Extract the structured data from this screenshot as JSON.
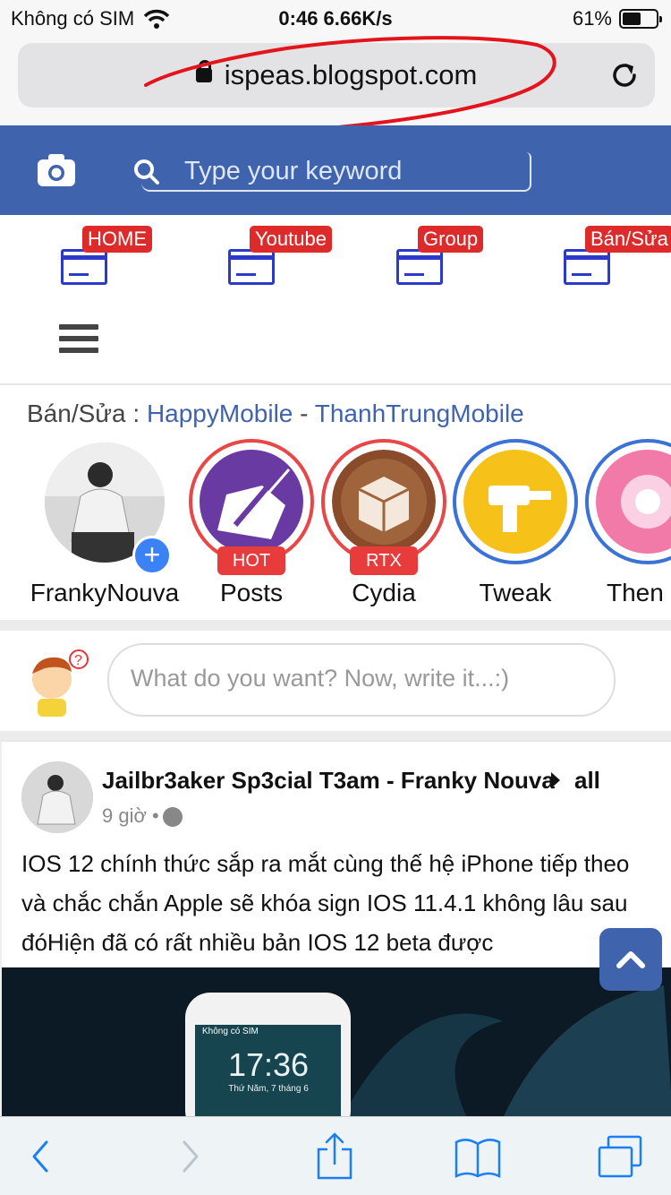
{
  "status_bar": {
    "carrier": "Không có SIM",
    "time_speed": "0:46 6.66K/s",
    "battery": "61%",
    "battery_level": 0.61
  },
  "browser": {
    "url": "ispeas.blogspot.com"
  },
  "header": {
    "search_placeholder": "Type your keyword"
  },
  "quicklinks": [
    {
      "label": "HOME"
    },
    {
      "label": "Youtube"
    },
    {
      "label": "Group"
    },
    {
      "label": "Bán/Sửa"
    }
  ],
  "stories_section": {
    "prefix": "Bán/Sửa : ",
    "link1": "HappyMobile",
    "sep": " - ",
    "link2": "ThanhTrungMobile",
    "items": [
      {
        "label": "FrankyNouva",
        "badge": ""
      },
      {
        "label": "Posts",
        "badge": "HOT"
      },
      {
        "label": "Cydia",
        "badge": "RTX"
      },
      {
        "label": "Tweak",
        "badge": ""
      },
      {
        "label": "Then",
        "badge": ""
      }
    ]
  },
  "compose": {
    "placeholder": "What do you want? Now, write it...:)"
  },
  "post": {
    "author": "Jailbr3aker Sp3cial T3am - Franky Nouva",
    "audience": "all",
    "time": "9 giờ •",
    "text": "IOS 12 chính thức sắp ra mắt cùng thế hệ iPhone tiếp theo và chắc chắn Apple sẽ khóa sign IOS 11.4.1 không lâu sau đóHiện đã có rất nhiều bản IOS 12 beta được",
    "image_time": "17:36",
    "image_date": "Thứ Năm, 7 tháng 6",
    "image_carrier": "Không có SIM"
  },
  "colors": {
    "brand": "#3f63ad",
    "badge_red": "#dd2b2b",
    "link_blue": "#3f63ad",
    "ios_blue": "#1a7ef5"
  }
}
